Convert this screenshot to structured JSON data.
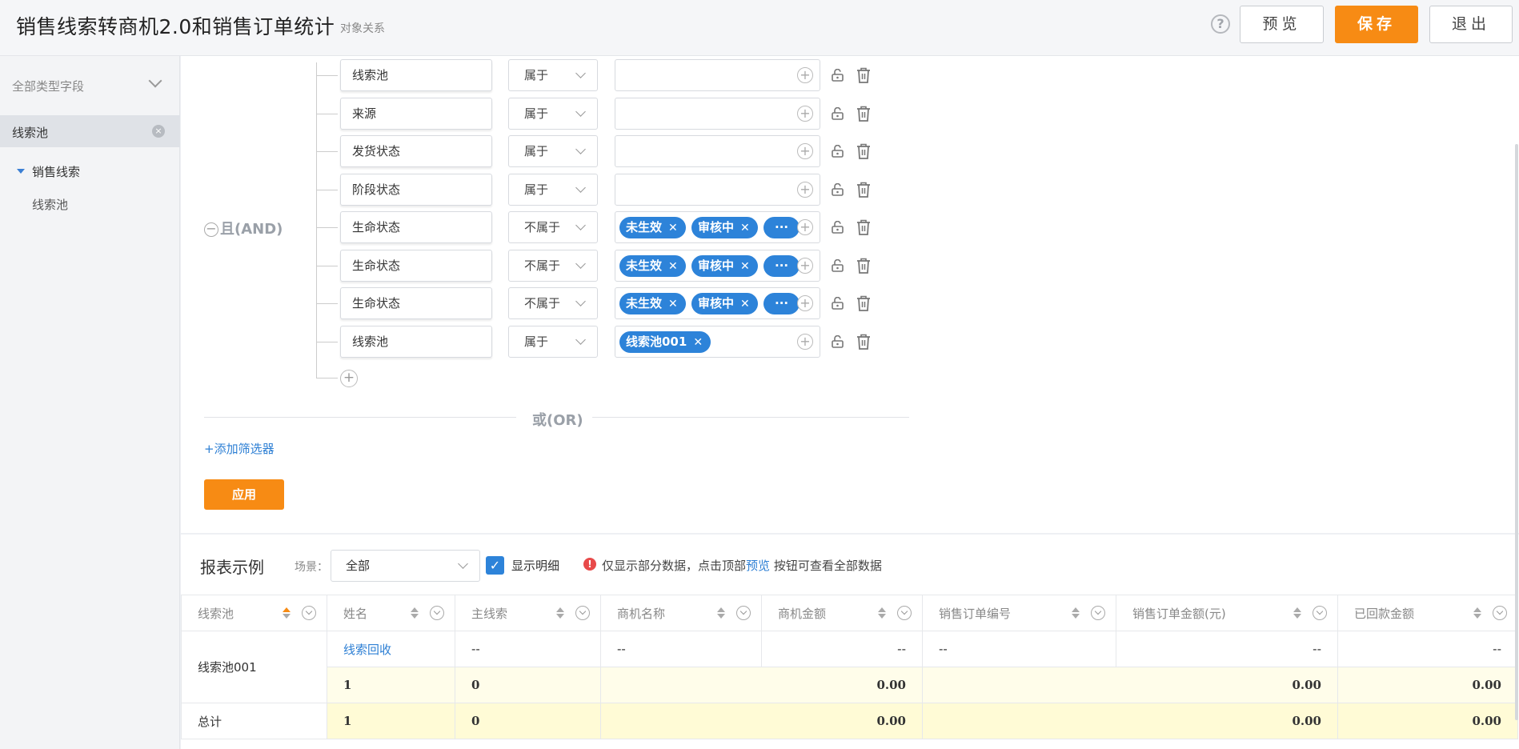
{
  "header": {
    "title": "销售线索转商机2.0和销售订单统计",
    "subtitle": "对象关系",
    "help_icon": "?",
    "preview_label": "预览",
    "save_label": "保存",
    "exit_label": "退出"
  },
  "sidebar": {
    "field_type": "全部类型字段",
    "search_value": "线索池",
    "clear_icon": "×",
    "tree": {
      "parent": "销售线索",
      "child": "线索池"
    }
  },
  "filter": {
    "group_label": "且(AND)",
    "collapse_icon": "−",
    "rows": [
      {
        "field": "线索池",
        "op": "属于",
        "tags": []
      },
      {
        "field": "来源",
        "op": "属于",
        "tags": []
      },
      {
        "field": "发货状态",
        "op": "属于",
        "tags": []
      },
      {
        "field": "阶段状态",
        "op": "属于",
        "tags": []
      },
      {
        "field": "生命状态",
        "op": "不属于",
        "tags": [
          "未生效",
          "审核中",
          "···"
        ]
      },
      {
        "field": "生命状态",
        "op": "不属于",
        "tags": [
          "未生效",
          "审核中",
          "···"
        ]
      },
      {
        "field": "生命状态",
        "op": "不属于",
        "tags": [
          "未生效",
          "审核中",
          "···"
        ]
      },
      {
        "field": "线索池",
        "op": "属于",
        "tags": [
          "线索池001"
        ]
      }
    ],
    "plus_icon": "+",
    "or_label": "或(OR)",
    "add_filter_label": "+添加筛选器",
    "apply_label": "应用"
  },
  "report": {
    "title": "报表示例",
    "scene_label": "场景：",
    "scene_value": "全部",
    "show_detail_label": "显示明细",
    "checkmark": "✓",
    "warn_icon": "!",
    "note_prefix": "仅显示部分数据，点击顶部",
    "note_link": "预览",
    "note_suffix": "按钮可查看全部数据",
    "columns": [
      "线索池",
      "姓名",
      "主线索",
      "商机名称",
      "商机金额",
      "销售订单编号",
      "销售订单金额(元)",
      "已回款金额"
    ],
    "detail_row": {
      "group": "线索池001",
      "name": "线索回收",
      "main_lead": "--",
      "opp_name": "--",
      "opp_amount": "--",
      "order_no": "--",
      "order_amount": "--",
      "paid": "--"
    },
    "subtotal_row": {
      "name": "1",
      "main_lead": "0",
      "opp_amount": "0.00",
      "order_amount": "0.00",
      "paid": "0.00"
    },
    "total_row": {
      "label": "总计",
      "name": "1",
      "main_lead": "0",
      "opp_amount": "0.00",
      "order_amount": "0.00",
      "paid": "0.00"
    }
  }
}
